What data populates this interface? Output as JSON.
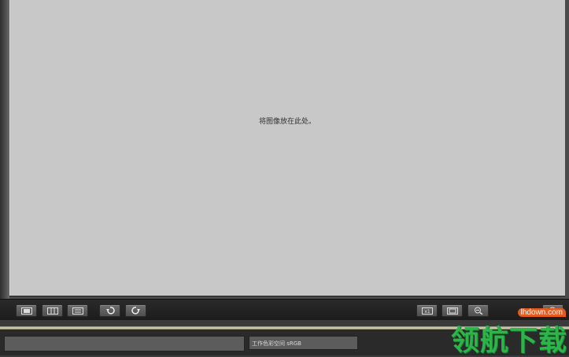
{
  "canvas": {
    "drop_hint": "将图像放在此处。"
  },
  "toolbar": {
    "left_buttons": [
      "filmstrip-view-icon",
      "split-view-icon",
      "list-view-icon",
      "rotate-left-icon",
      "rotate-right-icon"
    ],
    "right_buttons": [
      "actual-size-icon",
      "fit-to-window-icon",
      "zoom-out-icon",
      "zoom-in-icon"
    ]
  },
  "status": {
    "left_text": "",
    "color_space": "工作色彩空间 sRGB"
  },
  "watermark": {
    "url": "lhdown.com",
    "text": "领航下载"
  },
  "colors": {
    "canvas_bg": "#c8c8c8",
    "toolbar_bg": "#1c1c1c",
    "watermark_green": "#2db54a",
    "watermark_orange": "#e25a1e"
  }
}
